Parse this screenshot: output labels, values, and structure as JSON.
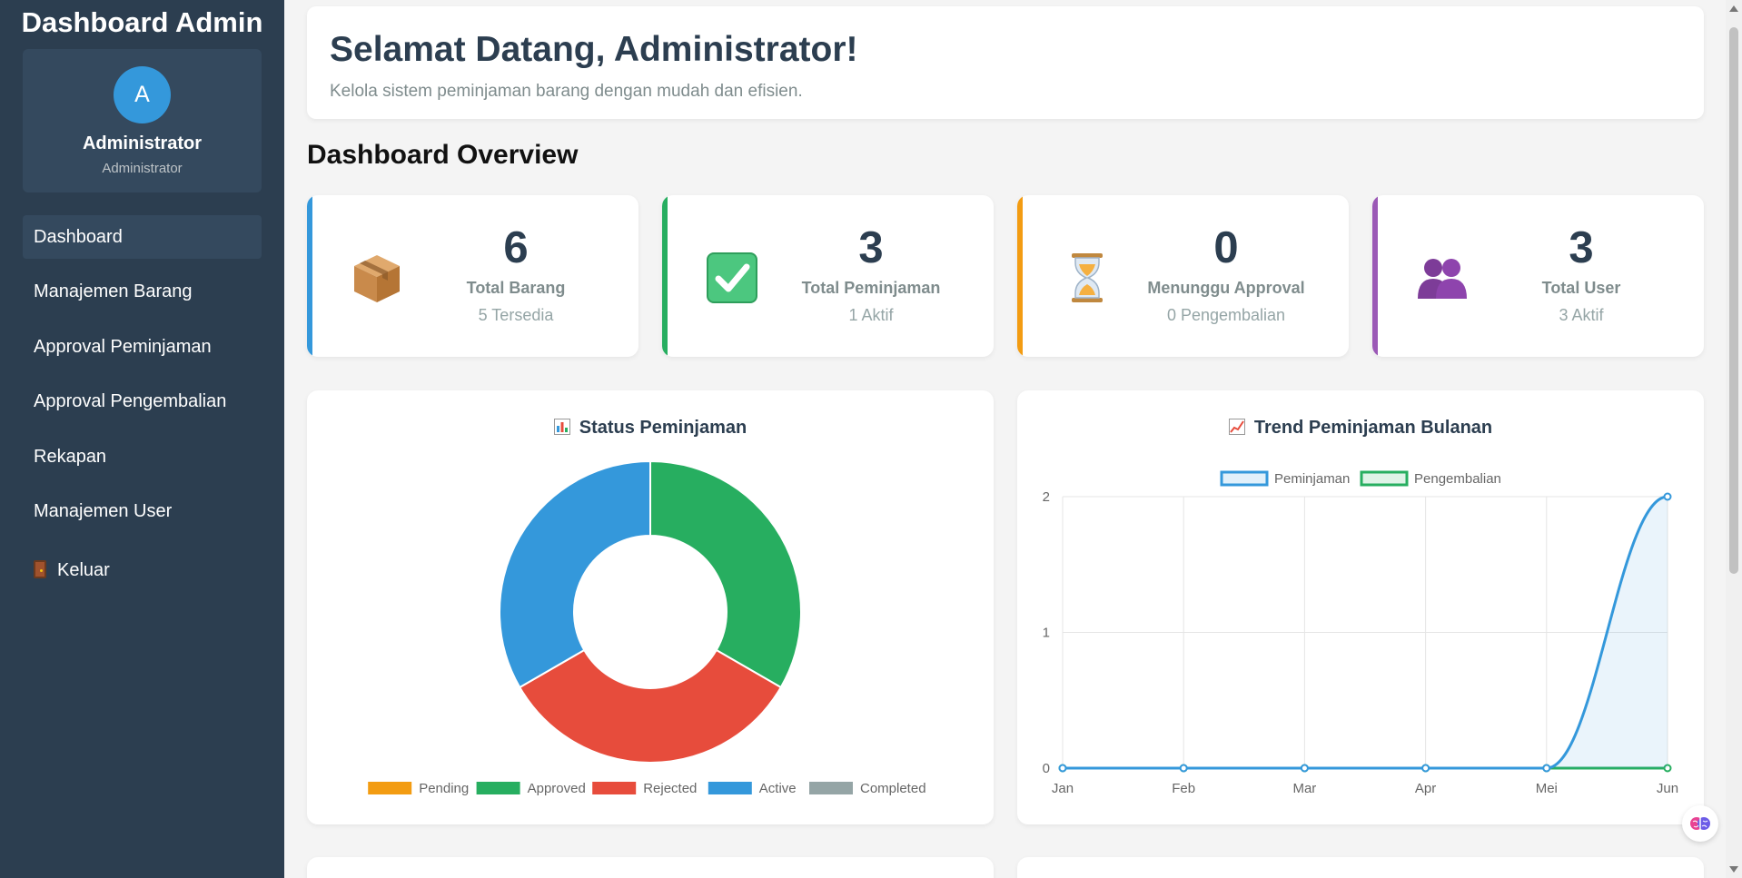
{
  "sidebar": {
    "title": "Dashboard Admin",
    "profile": {
      "avatar_letter": "A",
      "name": "Administrator",
      "role": "Administrator"
    },
    "items": [
      {
        "label": "Dashboard"
      },
      {
        "label": "Manajemen Barang"
      },
      {
        "label": "Approval Peminjaman"
      },
      {
        "label": "Approval Pengembalian"
      },
      {
        "label": "Rekapan"
      },
      {
        "label": "Manajemen User"
      }
    ],
    "logout_label": "Keluar"
  },
  "welcome": {
    "title": "Selamat Datang, Administrator!",
    "subtitle": "Kelola sistem peminjaman barang dengan mudah dan efisien."
  },
  "overview_title": "Dashboard Overview",
  "stats": [
    {
      "value": "6",
      "label": "Total Barang",
      "sub": "5 Tersedia",
      "color": "#3498db",
      "icon": "package-icon"
    },
    {
      "value": "3",
      "label": "Total Peminjaman",
      "sub": "1 Aktif",
      "color": "#27ae60",
      "icon": "check-icon"
    },
    {
      "value": "0",
      "label": "Menunggu Approval",
      "sub": "0 Pengembalian",
      "color": "#f39c12",
      "icon": "hourglass-icon"
    },
    {
      "value": "3",
      "label": "Total User",
      "sub": "3 Aktif",
      "color": "#9b59b6",
      "icon": "users-icon"
    }
  ],
  "chart_data": [
    {
      "type": "pie",
      "title": "Status Peminjaman",
      "categories": [
        "Pending",
        "Approved",
        "Rejected",
        "Active",
        "Completed"
      ],
      "values": [
        0,
        1,
        1,
        1,
        0
      ],
      "colors": [
        "#f39c12",
        "#27ae60",
        "#e74c3c",
        "#3498db",
        "#95a5a6"
      ],
      "legend": "bottom"
    },
    {
      "type": "line",
      "title": "Trend Peminjaman Bulanan",
      "categories": [
        "Jan",
        "Feb",
        "Mar",
        "Apr",
        "Mei",
        "Jun"
      ],
      "series": [
        {
          "name": "Peminjaman",
          "values": [
            0,
            0,
            0,
            0,
            0,
            2
          ],
          "color": "#3498db"
        },
        {
          "name": "Pengembalian",
          "values": [
            0,
            0,
            0,
            0,
            0,
            0
          ],
          "color": "#27ae60"
        }
      ],
      "ylim": [
        0,
        2
      ],
      "yticks": [
        "0",
        "1",
        "2"
      ],
      "grid": true,
      "legend": "top"
    }
  ]
}
